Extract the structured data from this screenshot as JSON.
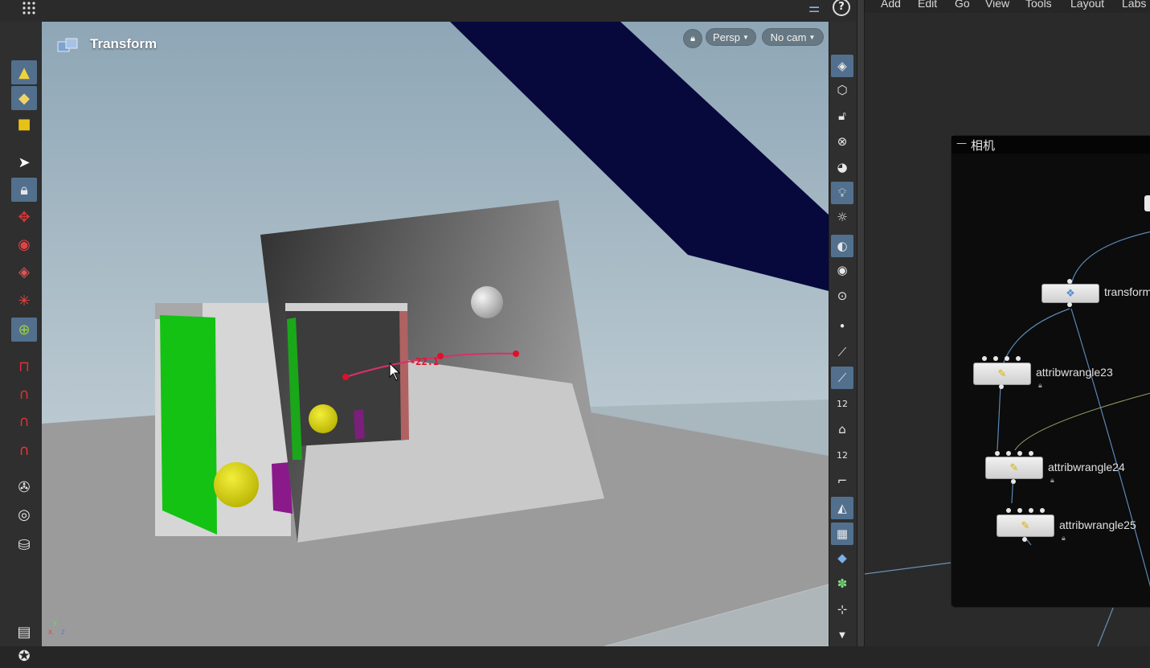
{
  "viewport": {
    "title": "Transform",
    "view_mode": "Persp",
    "camera": "No cam",
    "handle_readout": "-22.1",
    "axis_labels": {
      "x": "x",
      "y": "y",
      "z": "z"
    }
  },
  "menu": {
    "items": [
      "Add",
      "Edit",
      "Go",
      "View",
      "Tools",
      "Layout",
      "Labs"
    ]
  },
  "network": {
    "box_title": "相机",
    "nodes": [
      {
        "name": "transform",
        "label": "transform"
      },
      {
        "name": "attribwrangle23",
        "label": "attribwrangle23"
      },
      {
        "name": "attribwrangle24",
        "label": "attribwrangle24"
      },
      {
        "name": "attribwrangle25",
        "label": "attribwrangle25"
      }
    ]
  },
  "icons": {
    "help": "?",
    "hot_top_right_1": "12",
    "hot_top_right_2": "12"
  },
  "colors": {
    "accent_active": "#52708d",
    "sky": "#a6b8c2",
    "ground": "#9a9a9a",
    "navy_beam": "#07093d",
    "green_box": "#14c214",
    "yellow_sphere": "#d4d000",
    "purple_block": "#8a1a8a",
    "handle_red": "#e0102a"
  }
}
